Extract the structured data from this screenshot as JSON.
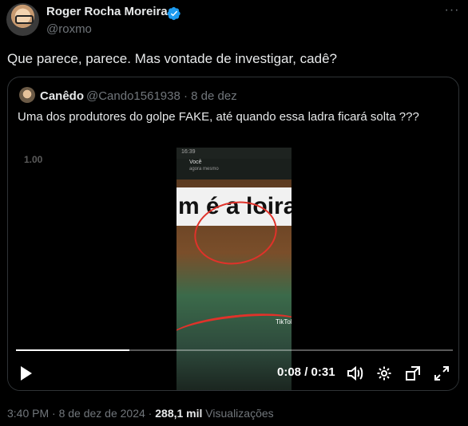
{
  "author": {
    "name": "Roger Rocha Moreira",
    "handle": "@roxmo"
  },
  "tweet": {
    "text": "Que parece, parece. Mas vontade de investigar, cadê?"
  },
  "quote": {
    "name": "Canêdo",
    "handle_date": "@Cando1561938 · 8 de dez",
    "text": "Uma dos produtores do golpe FAKE, até quando essa ladra ficará solta ???"
  },
  "video": {
    "playback_speed": "1.00",
    "time": "0:08 / 0:31",
    "progress": 0.26,
    "frame": {
      "status": "16:39",
      "user": "Você",
      "user_sub": "agora mesmo",
      "banner": "m é a loira",
      "watermark": "TikTok"
    }
  },
  "meta": {
    "timestamp": "3:40 PM · 8 de dez de 2024",
    "sep": " · ",
    "views_count": "288,1 mil",
    "views_label": " Visualizações"
  },
  "colors": {
    "verified": "#1d9bf0",
    "secondary_text": "#71767b",
    "border": "#2f3336",
    "annotation": "#e0322a"
  }
}
